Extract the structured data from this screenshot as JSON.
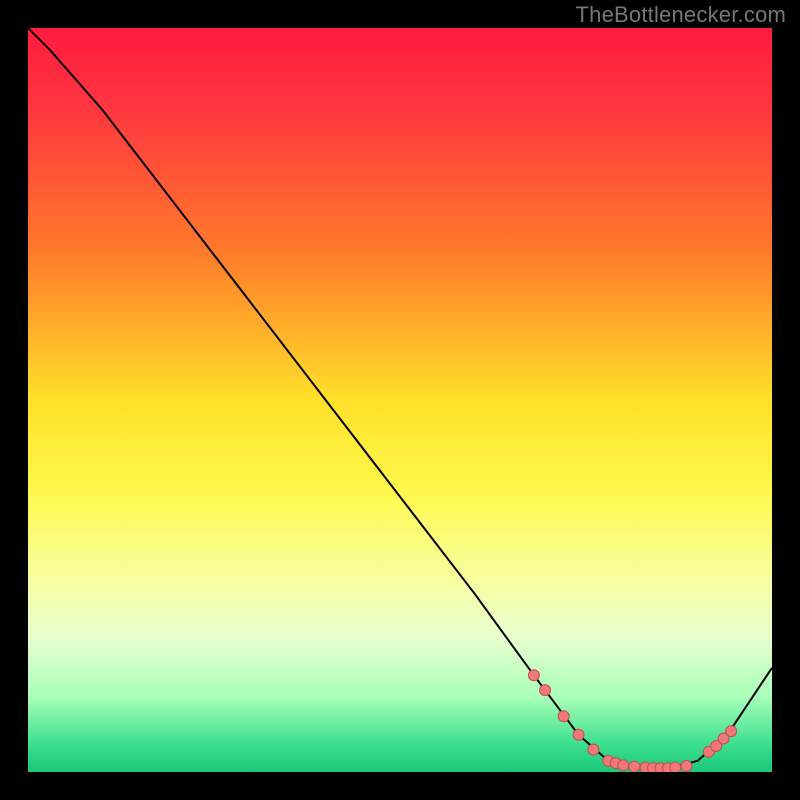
{
  "attribution": "TheBottlenecker.com",
  "colors": {
    "page_bg": "#000000",
    "curve": "#000000",
    "dot_fill": "#f07878",
    "dot_stroke": "#c05050",
    "gradient_stops": [
      {
        "offset": 0.0,
        "color": "#ff1a3f"
      },
      {
        "offset": 0.12,
        "color": "#ff3a3f"
      },
      {
        "offset": 0.3,
        "color": "#ff7a2a"
      },
      {
        "offset": 0.5,
        "color": "#ffe02a"
      },
      {
        "offset": 0.62,
        "color": "#fff84a"
      },
      {
        "offset": 0.74,
        "color": "#f8ffa0"
      },
      {
        "offset": 0.82,
        "color": "#e8ffd0"
      },
      {
        "offset": 0.9,
        "color": "#a8ffb8"
      },
      {
        "offset": 0.96,
        "color": "#40e090"
      },
      {
        "offset": 1.0,
        "color": "#18c878"
      }
    ]
  },
  "chart_data": {
    "type": "line",
    "title": "",
    "xlabel": "",
    "ylabel": "",
    "xlim": [
      0,
      100
    ],
    "ylim": [
      0,
      100
    ],
    "series": [
      {
        "name": "curve",
        "x": [
          0,
          3,
          10,
          20,
          30,
          40,
          50,
          60,
          68,
          74,
          78,
          82,
          86,
          90,
          94,
          100
        ],
        "y": [
          100,
          97,
          89,
          76,
          63,
          50,
          37,
          24,
          13,
          5,
          1.5,
          0.5,
          0.5,
          1.5,
          5,
          14
        ]
      }
    ],
    "dots": {
      "x": [
        68.0,
        69.5,
        72.0,
        74.0,
        76.0,
        78.0,
        79.0,
        80.0,
        81.5,
        83.0,
        84.0,
        85.0,
        86.0,
        87.0,
        88.5,
        91.5,
        92.5,
        93.5,
        94.5
      ],
      "y": [
        13.0,
        11.0,
        7.5,
        5.0,
        3.0,
        1.5,
        1.2,
        0.9,
        0.7,
        0.6,
        0.5,
        0.5,
        0.5,
        0.6,
        0.8,
        2.7,
        3.5,
        4.5,
        5.5
      ]
    }
  }
}
